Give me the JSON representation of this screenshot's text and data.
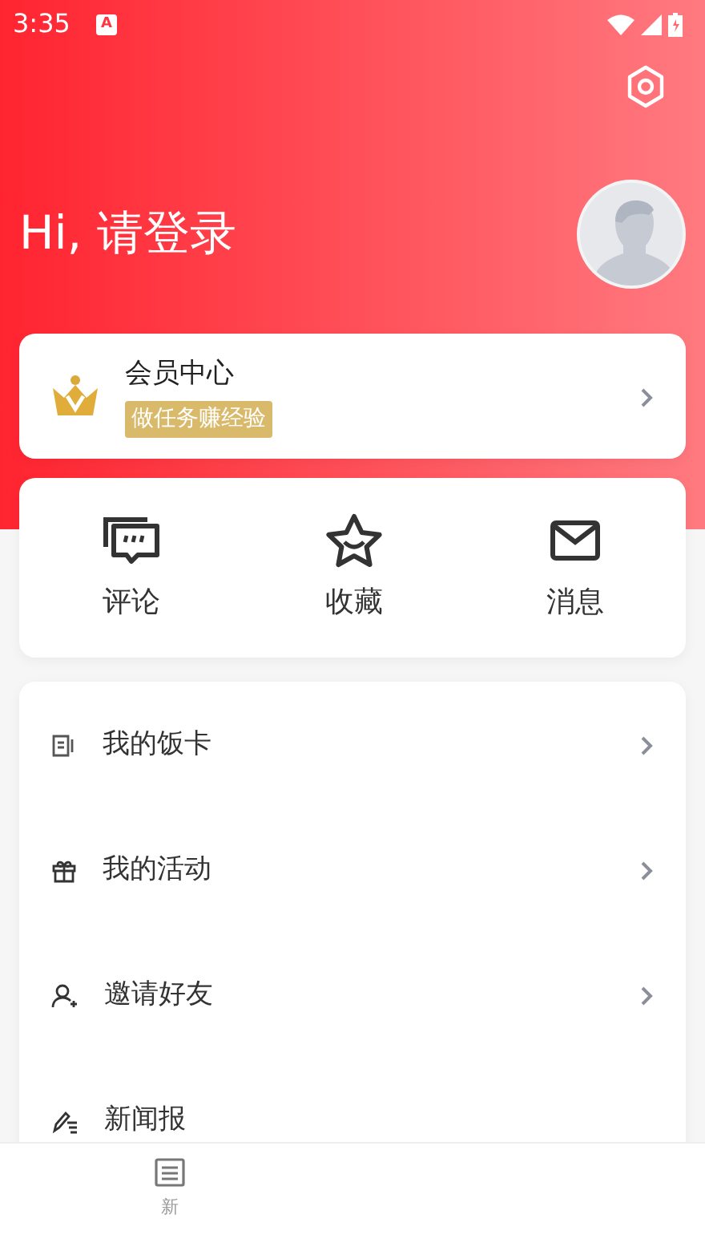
{
  "status_bar": {
    "time": "3:35",
    "badge": "A"
  },
  "profile": {
    "greeting": "Hi, 请登录"
  },
  "member_card": {
    "title": "会员中心",
    "tag": "做任务赚经验"
  },
  "shortcuts": [
    {
      "kind": "comment",
      "label": "评论"
    },
    {
      "kind": "star",
      "label": "收藏"
    },
    {
      "kind": "mail",
      "label": "消息"
    }
  ],
  "menu": [
    {
      "kind": "card",
      "label": "我的饭卡",
      "chevron": true
    },
    {
      "kind": "gift",
      "label": "我的活动",
      "chevron": true
    },
    {
      "kind": "invite",
      "label": "邀请好友",
      "chevron": true
    },
    {
      "kind": "edit",
      "label": "新闻报",
      "chevron": false
    }
  ],
  "bottom_nav": [
    {
      "kind": "news",
      "label": "新"
    }
  ]
}
